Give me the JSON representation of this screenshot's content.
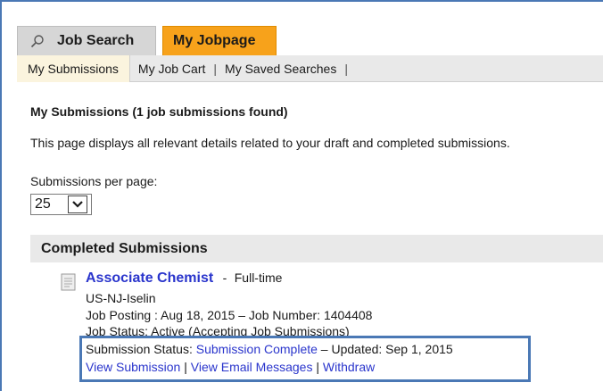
{
  "tabs": {
    "job_search": "Job Search",
    "my_jobpage": "My Jobpage"
  },
  "subnav": {
    "items": [
      "My Submissions",
      "My Job Cart",
      "My Saved Searches"
    ],
    "separator": "|"
  },
  "page": {
    "heading": "My Submissions (1 job submissions found)",
    "description": "This page displays all relevant details related to your draft and completed submissions.",
    "per_page_label": "Submissions per page:",
    "per_page_value": "25"
  },
  "section": {
    "title": "Completed Submissions"
  },
  "job": {
    "title": "Associate Chemist",
    "type_sep": "-",
    "type": "Full-time",
    "location": "US-NJ-Iselin",
    "posting": "Job Posting : Aug 18, 2015 – Job Number: 1404408",
    "job_status": "Job Status: Active (Accepting Job Submissions)",
    "submission_status_label": "Submission Status:",
    "submission_status_value": "Submission Complete",
    "updated": "– Updated: Sep 1, 2015"
  },
  "actions": {
    "view_submission": "View Submission",
    "view_email": "View Email Messages",
    "withdraw": "Withdraw",
    "separator": "|"
  },
  "colors": {
    "accent_orange": "#f7a21b",
    "link_blue": "#2a35cc",
    "highlight_border": "#4a78b5"
  }
}
